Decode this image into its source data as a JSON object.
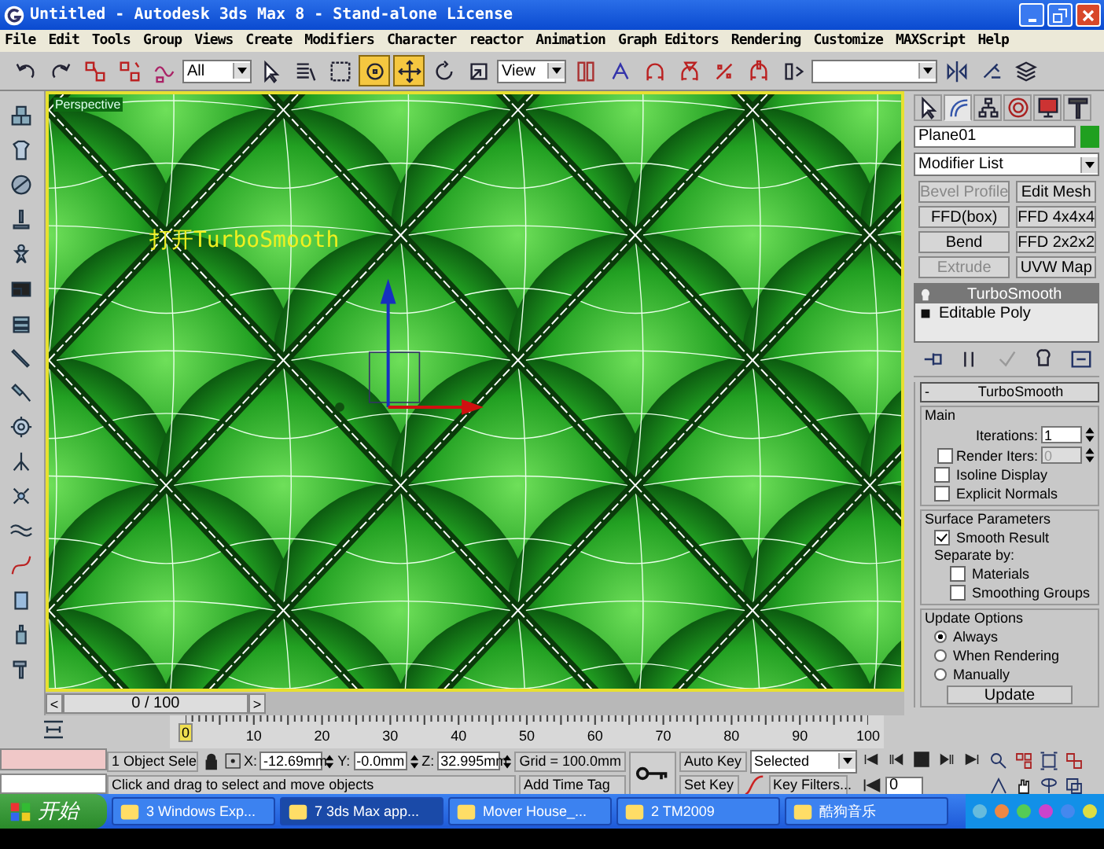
{
  "window": {
    "title": "Untitled - Autodesk 3ds Max 8  - Stand-alone License"
  },
  "menu": [
    "File",
    "Edit",
    "Tools",
    "Group",
    "Views",
    "Create",
    "Modifiers",
    "Character",
    "reactor",
    "Animation",
    "Graph Editors",
    "Rendering",
    "Customize",
    "MAXScript",
    "Help"
  ],
  "toolbar": {
    "items": [
      {
        "kind": "tool",
        "selected": false
      },
      {
        "kind": "tool",
        "selected": false
      },
      {
        "kind": "tool",
        "selected": false
      },
      {
        "kind": "tool",
        "selected": false
      },
      {
        "kind": "tool",
        "selected": false
      },
      {
        "kind": "dropdown",
        "value": "All"
      },
      {
        "kind": "tool",
        "selected": false
      },
      {
        "kind": "tool",
        "selected": false
      },
      {
        "kind": "tool",
        "selected": false
      },
      {
        "kind": "tool",
        "selected": true
      },
      {
        "kind": "tool",
        "selected": true
      },
      {
        "kind": "tool",
        "selected": false
      },
      {
        "kind": "tool",
        "selected": false
      },
      {
        "kind": "dropdown",
        "value": "View"
      },
      {
        "kind": "tool",
        "selected": false
      },
      {
        "kind": "tool",
        "selected": false
      },
      {
        "kind": "tool",
        "selected": false
      },
      {
        "kind": "tool",
        "selected": false
      },
      {
        "kind": "tool",
        "selected": false
      },
      {
        "kind": "tool",
        "selected": false
      },
      {
        "kind": "tool",
        "selected": false
      },
      {
        "kind": "dropdown"
      },
      {
        "kind": "tool",
        "selected": false
      },
      {
        "kind": "tool",
        "selected": false
      },
      {
        "kind": "tool",
        "selected": false
      }
    ]
  },
  "viewport": {
    "label": "Perspective",
    "annotation": "打开TurboSmooth"
  },
  "command_panel": {
    "tabs": [
      {
        "selected": false
      },
      {
        "selected": true
      },
      {
        "selected": false
      },
      {
        "selected": false
      },
      {
        "selected": false
      },
      {
        "selected": false
      }
    ],
    "object_name": "Plane01",
    "modifier_list": "Modifier List",
    "modifier_buttons": [
      {
        "label": "Bevel Profile",
        "disabled": true
      },
      {
        "label": "Edit Mesh",
        "disabled": false
      },
      {
        "label": "FFD(box)",
        "disabled": false
      },
      {
        "label": "FFD 4x4x4",
        "disabled": false
      },
      {
        "label": "Bend",
        "disabled": false
      },
      {
        "label": "FFD 2x2x2",
        "disabled": false
      },
      {
        "label": "Extrude",
        "disabled": true
      },
      {
        "label": "UVW Map",
        "disabled": false
      }
    ],
    "stack": [
      {
        "label": "TurboSmooth",
        "selected": true
      },
      {
        "label": "Editable Poly",
        "selected": false
      }
    ],
    "rollout": {
      "sign": "-",
      "title": "TurboSmooth",
      "main": {
        "title": "Main",
        "iterations": {
          "label": "Iterations:",
          "value": "1"
        },
        "render_iters": {
          "label": "Render Iters:",
          "value": "0",
          "checked": false
        },
        "options": [
          {
            "label": "Isoline Display",
            "checked": false
          },
          {
            "label": "Explicit Normals",
            "checked": false
          }
        ]
      },
      "surface": {
        "title": "Surface Parameters",
        "smooth_result": {
          "label": "Smooth Result",
          "checked": true
        },
        "separate_label": "Separate by:",
        "separate": [
          {
            "label": "Materials",
            "checked": false
          },
          {
            "label": "Smoothing Groups",
            "checked": false
          }
        ]
      },
      "update": {
        "title": "Update Options",
        "options": [
          {
            "label": "Always",
            "selected": true
          },
          {
            "label": "When Rendering",
            "selected": false
          },
          {
            "label": "Manually",
            "selected": false
          }
        ],
        "button": "Update"
      }
    }
  },
  "time_slider": {
    "prev": "<",
    "position": "0 / 100",
    "next": ">"
  },
  "track_bar": {
    "ticks": [
      "0",
      "10",
      "20",
      "30",
      "40",
      "50",
      "60",
      "70",
      "80",
      "90",
      "100"
    ]
  },
  "status": {
    "selection": "1 Object Sele",
    "x_label": "X:",
    "x": "-12.69mm",
    "y_label": "Y:",
    "y": "-0.0mm",
    "z_label": "Z:",
    "z": "32.995mm",
    "grid": "Grid = 100.0mm",
    "prompt": "Click and drag to select and move objects",
    "time_tag": "Add Time Tag",
    "auto_key": "Auto Key",
    "set_key": "Set Key",
    "key_mode": "Selected",
    "key_filters": "Key Filters...",
    "frame": "0"
  },
  "taskbar": {
    "start": "开始",
    "tasks": [
      {
        "label": "3 Windows Exp...",
        "selected": false
      },
      {
        "label": "7 3ds Max app...",
        "selected": true
      },
      {
        "label": "Mover House_...",
        "selected": false
      },
      {
        "label": "2 TM2009",
        "selected": false
      },
      {
        "label": "酷狗音乐",
        "selected": false
      }
    ]
  }
}
